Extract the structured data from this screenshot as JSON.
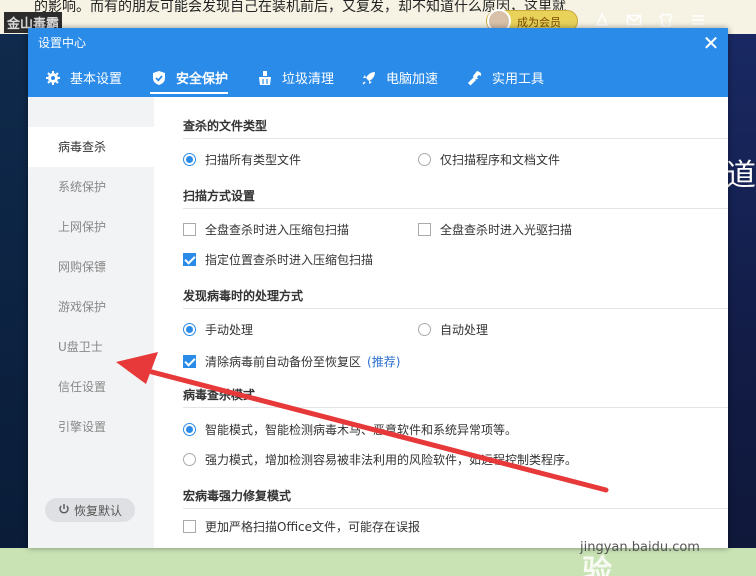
{
  "background": {
    "logo_text": "金山毒霸",
    "article_snippet": "的影响。而有的朋友可能会发现自己在装机前后，又复发，却不知道什么原因，这里就",
    "member_label": "成为会员",
    "side_glyph": "道"
  },
  "dialog": {
    "title": "设置中心",
    "close_glyph": "✕",
    "tabs": [
      {
        "label": "基本设置",
        "icon": "gear-icon"
      },
      {
        "label": "安全保护",
        "icon": "shield-check-icon"
      },
      {
        "label": "垃圾清理",
        "icon": "broom-icon"
      },
      {
        "label": "电脑加速",
        "icon": "rocket-icon"
      },
      {
        "label": "实用工具",
        "icon": "wrench-icon"
      }
    ],
    "active_tab": "安全保护"
  },
  "sidebar": {
    "items": [
      "病毒查杀",
      "系统保护",
      "上网保护",
      "网购保镖",
      "游戏保护",
      "U盘卫士",
      "信任设置",
      "引擎设置"
    ],
    "active": "病毒查杀",
    "restore_label": "恢复默认"
  },
  "content": {
    "file_types": {
      "title": "查杀的文件类型",
      "all_files": "扫描所有类型文件",
      "programs_docs": "仅扫描程序和文档文件",
      "selected": "all_files"
    },
    "scan_mode": {
      "title": "扫描方式设置",
      "full_zip": {
        "label": "全盘查杀时进入压缩包扫描",
        "checked": false
      },
      "full_optical": {
        "label": "全盘查杀时进入光驱扫描",
        "checked": false
      },
      "custom_zip": {
        "label": "指定位置查杀时进入压缩包扫描",
        "checked": true
      }
    },
    "virus_handling": {
      "title": "发现病毒时的处理方式",
      "manual": "手动处理",
      "auto": "自动处理",
      "selected": "manual",
      "backup": {
        "label": "清除病毒前自动备份至恢复区",
        "checked": true,
        "tag": "(推荐)"
      }
    },
    "scan_engine_mode": {
      "title": "病毒查杀模式",
      "smart": "智能模式，智能检测病毒木马、恶意软件和系统异常项等。",
      "strong": "强力模式，增加检测容易被非法利用的风险软件，如远程控制类程序。",
      "selected": "smart"
    },
    "macro_repair": {
      "title": "宏病毒强力修复模式",
      "strict_office": {
        "label": "更加严格扫描Office文件，可能存在误报",
        "checked": false
      }
    }
  },
  "watermark": {
    "logo": "Baidu 经验",
    "url": "jingyan.baidu.com"
  },
  "colors": {
    "header_blue": "#2b8be8",
    "annotation_red": "#e8393a",
    "sidebar_bg": "#f2f3f5"
  }
}
